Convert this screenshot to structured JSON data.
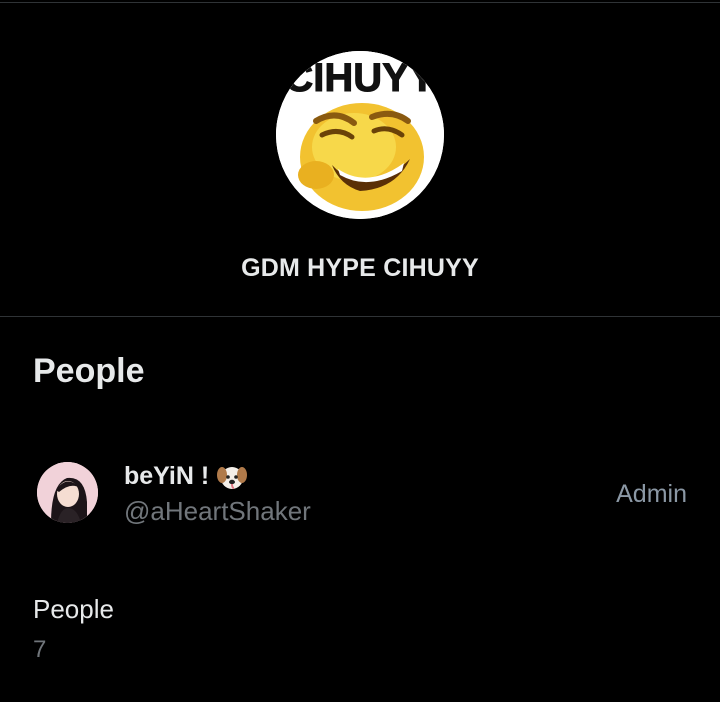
{
  "group": {
    "avatar_text": "CIHUYY",
    "name": "GDM HYPE CIHUYY"
  },
  "people_section": {
    "title": "People",
    "members": [
      {
        "display_name": "beYiN !",
        "emoji": "dog-face-icon",
        "handle": "@aHeartShaker",
        "role": "Admin"
      }
    ]
  },
  "footer": {
    "label": "People",
    "count": "7"
  },
  "colors": {
    "background": "#000000",
    "primary_text": "#e7e9ea",
    "secondary_text": "#71767b",
    "divider": "#2f3336"
  }
}
